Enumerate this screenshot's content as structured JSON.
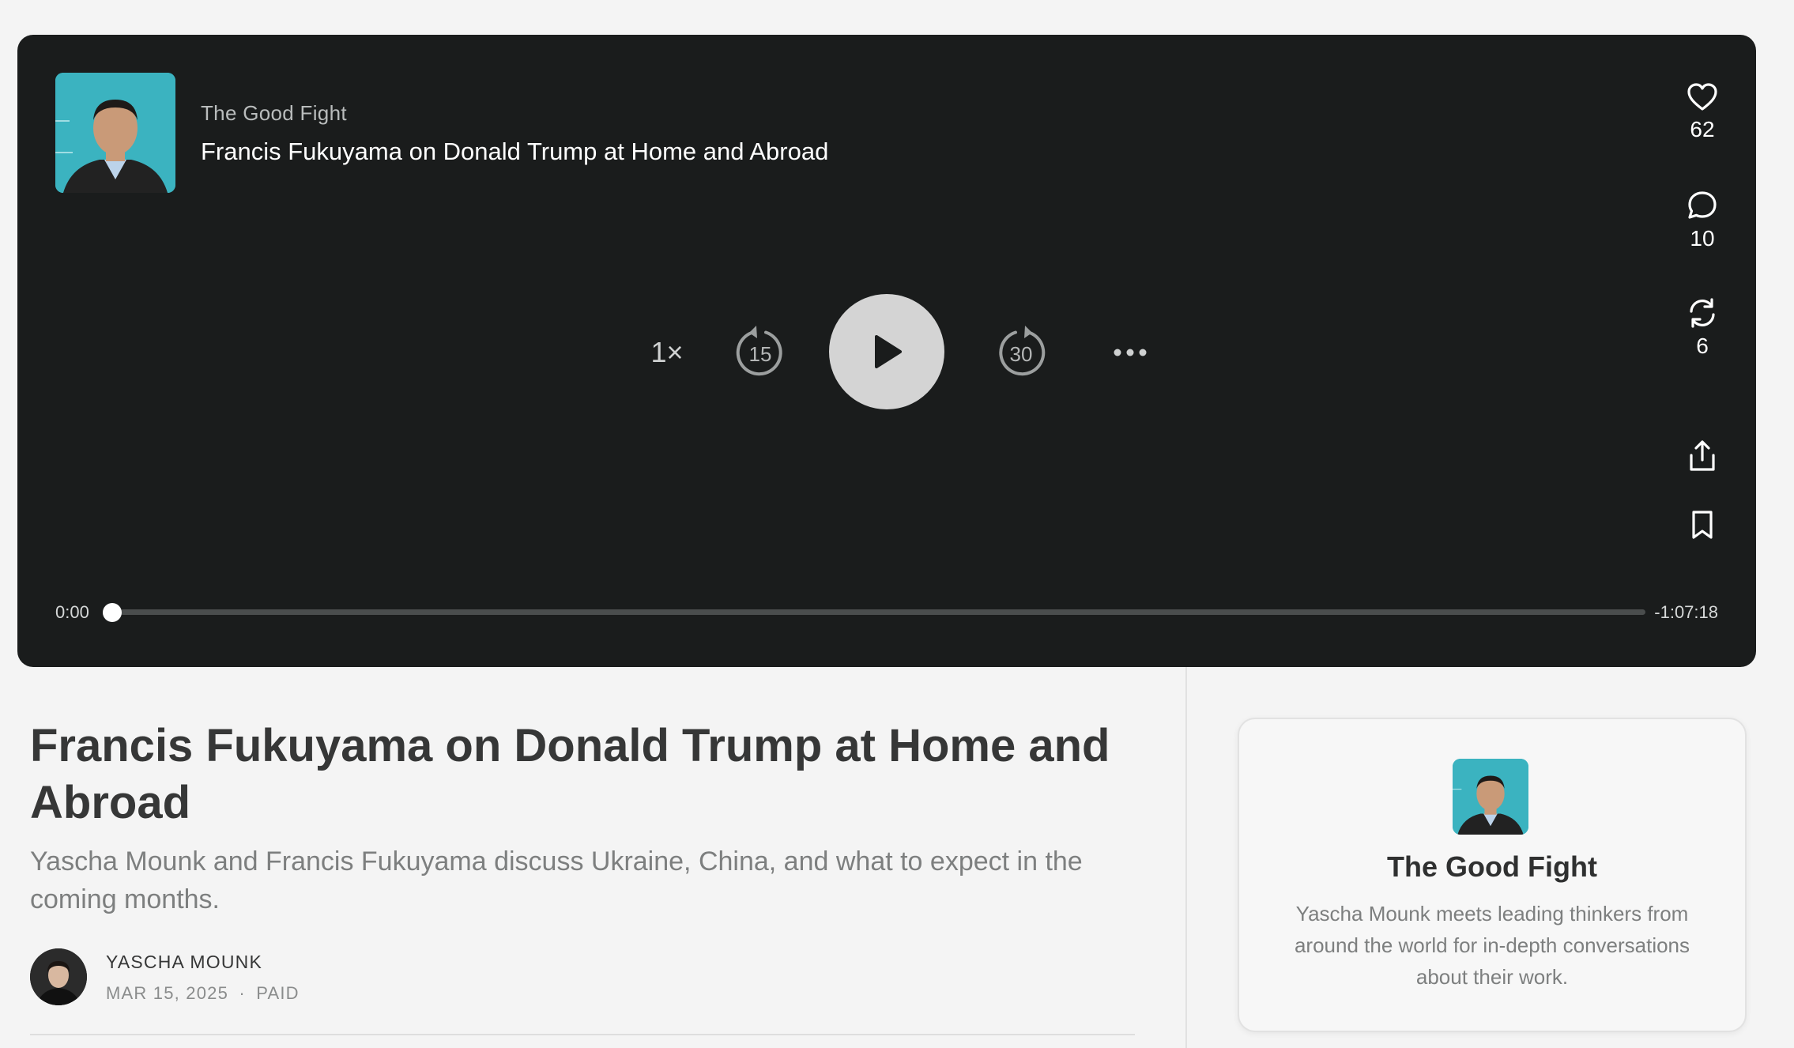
{
  "player": {
    "show_name": "The Good Fight",
    "episode_title": "Francis Fukuyama on Donald Trump at Home and Abroad",
    "speed": "1×",
    "skip_back_seconds": "15",
    "skip_forward_seconds": "30",
    "current_time": "0:00",
    "remaining_time": "-1:07:18",
    "progress": 0,
    "likes": "62",
    "comments": "10",
    "restacks": "6"
  },
  "article": {
    "title": "Francis Fukuyama on Donald Trump at Home and Abroad",
    "subtitle": "Yascha Mounk and Francis Fukuyama discuss Ukraine, China, and what to expect in the coming months.",
    "author": "YASCHA MOUNK",
    "date": "MAR 15, 2025",
    "separator": "·",
    "access": "PAID"
  },
  "publication_card": {
    "name": "The Good Fight",
    "description": "Yascha Mounk meets leading thinkers from around the world for in-depth conversations about their work."
  },
  "icons": {
    "like": "heart-icon",
    "comment": "comment-icon",
    "restack": "restack-icon",
    "share": "share-icon",
    "bookmark": "bookmark-icon",
    "more": "more-icon",
    "play": "play-icon",
    "skip_back": "rewind-15-icon",
    "skip_forward": "forward-30-icon"
  },
  "colors": {
    "player_bg": "#1a1c1c",
    "play_button": "#d4d4d4",
    "cover_teal": "#3bb3c0",
    "page_bg": "#f4f4f4"
  }
}
